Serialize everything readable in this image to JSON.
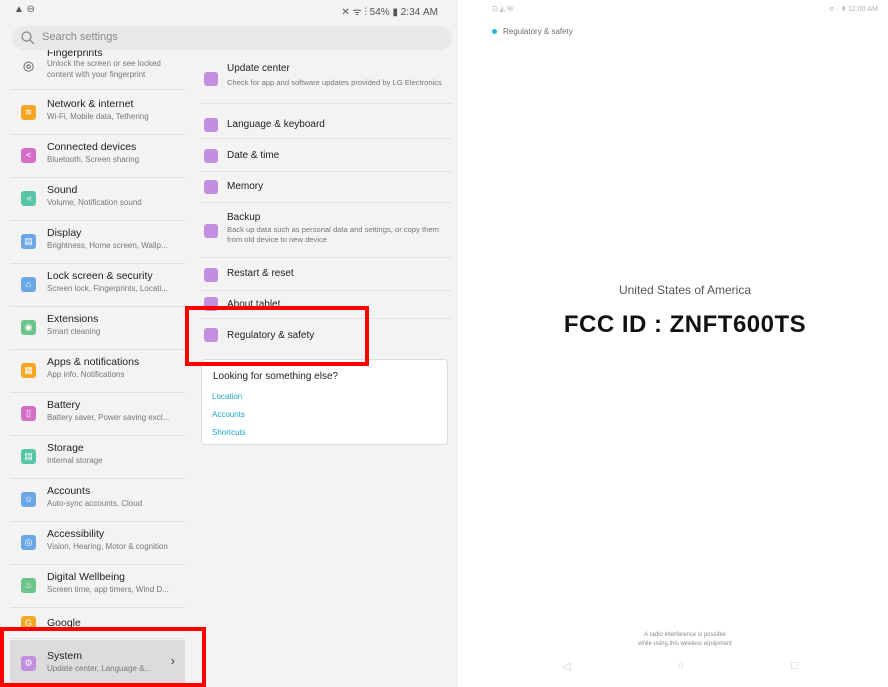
{
  "status_left": "▲ ⊖",
  "status_right": "✕ ᯤ ⫶ 54% ▮ 2:34 AM",
  "search": {
    "placeholder": "Search settings"
  },
  "sidebar": {
    "items": [
      {
        "title": "Fingerprints",
        "subtitle": "Unlock the screen or see locked content with your fingerprint",
        "icon": "fingerprint-icon",
        "color": "#888888"
      },
      {
        "title": "Network & internet",
        "subtitle": "Wi-Fi, Mobile data, Tethering",
        "icon": "wifi-icon",
        "color": "#f5a623"
      },
      {
        "title": "Connected devices",
        "subtitle": "Bluetooth, Screen sharing",
        "icon": "share-icon",
        "color": "#d46fc8"
      },
      {
        "title": "Sound",
        "subtitle": "Volume, Notification sound",
        "icon": "speaker-icon",
        "color": "#58c6a6"
      },
      {
        "title": "Display",
        "subtitle": "Brightness, Home screen, Wallp...",
        "icon": "display-icon",
        "color": "#6aa7e6"
      },
      {
        "title": "Lock screen & security",
        "subtitle": "Screen lock, Fingerprints, Locati...",
        "icon": "lock-icon",
        "color": "#6aa7e6"
      },
      {
        "title": "Extensions",
        "subtitle": "Smart cleaning",
        "icon": "extensions-icon",
        "color": "#6cc48b"
      },
      {
        "title": "Apps & notifications",
        "subtitle": "App info, Notifications",
        "icon": "apps-icon",
        "color": "#f5a623"
      },
      {
        "title": "Battery",
        "subtitle": "Battery saver, Power saving excl...",
        "icon": "battery-icon",
        "color": "#d46fc8"
      },
      {
        "title": "Storage",
        "subtitle": "Internal storage",
        "icon": "storage-icon",
        "color": "#58c6a6"
      },
      {
        "title": "Accounts",
        "subtitle": "Auto-sync accounts, Cloud",
        "icon": "accounts-icon",
        "color": "#6aa7e6"
      },
      {
        "title": "Accessibility",
        "subtitle": "Vision, Hearing, Motor & cognition",
        "icon": "accessibility-icon",
        "color": "#6aa7e6"
      },
      {
        "title": "Digital Wellbeing",
        "subtitle": "Screen time, app timers, Wind D...",
        "icon": "wellbeing-icon",
        "color": "#6cc48b"
      },
      {
        "title": "Google",
        "subtitle": "",
        "icon": "google-icon",
        "color": "#f5a623"
      },
      {
        "title": "System",
        "subtitle": "Update center, Language &...",
        "icon": "system-icon",
        "color": "#c28ee0",
        "chevron": "›"
      }
    ]
  },
  "system_items": [
    {
      "title": "Update center",
      "subtitle": "Check for app and software updates provided by LG Electronics",
      "icon": "update-icon"
    },
    {
      "title": "Language & keyboard",
      "subtitle": "",
      "icon": "language-icon"
    },
    {
      "title": "Date & time",
      "subtitle": "",
      "icon": "date-time-icon"
    },
    {
      "title": "Memory",
      "subtitle": "",
      "icon": "memory-icon"
    },
    {
      "title": "Backup",
      "subtitle": "Back up data such as personal data and settings, or copy them from old device to new device",
      "icon": "backup-icon"
    },
    {
      "title": "Restart & reset",
      "subtitle": "",
      "icon": "restart-icon"
    },
    {
      "title": "About tablet",
      "subtitle": "",
      "icon": "about-icon"
    },
    {
      "title": "Regulatory & safety",
      "subtitle": "",
      "icon": "regulatory-icon"
    }
  ],
  "looking": {
    "title": "Looking for something else?",
    "links": [
      "Location",
      "Accounts",
      "Shortcuts"
    ]
  },
  "regulatory_screen": {
    "status_left": "⊡ ◭ ✉",
    "status_right": "ᯤ ⫶ ▮ 12:00 AM",
    "header": "Regulatory & safety",
    "country": "United States of America",
    "fcc_id": "FCC ID : ZNFT600TS",
    "note_line1": "A radio interference is possible",
    "note_line2": "while using this wireless equipment",
    "nav": [
      "◁",
      "○",
      "□"
    ]
  }
}
